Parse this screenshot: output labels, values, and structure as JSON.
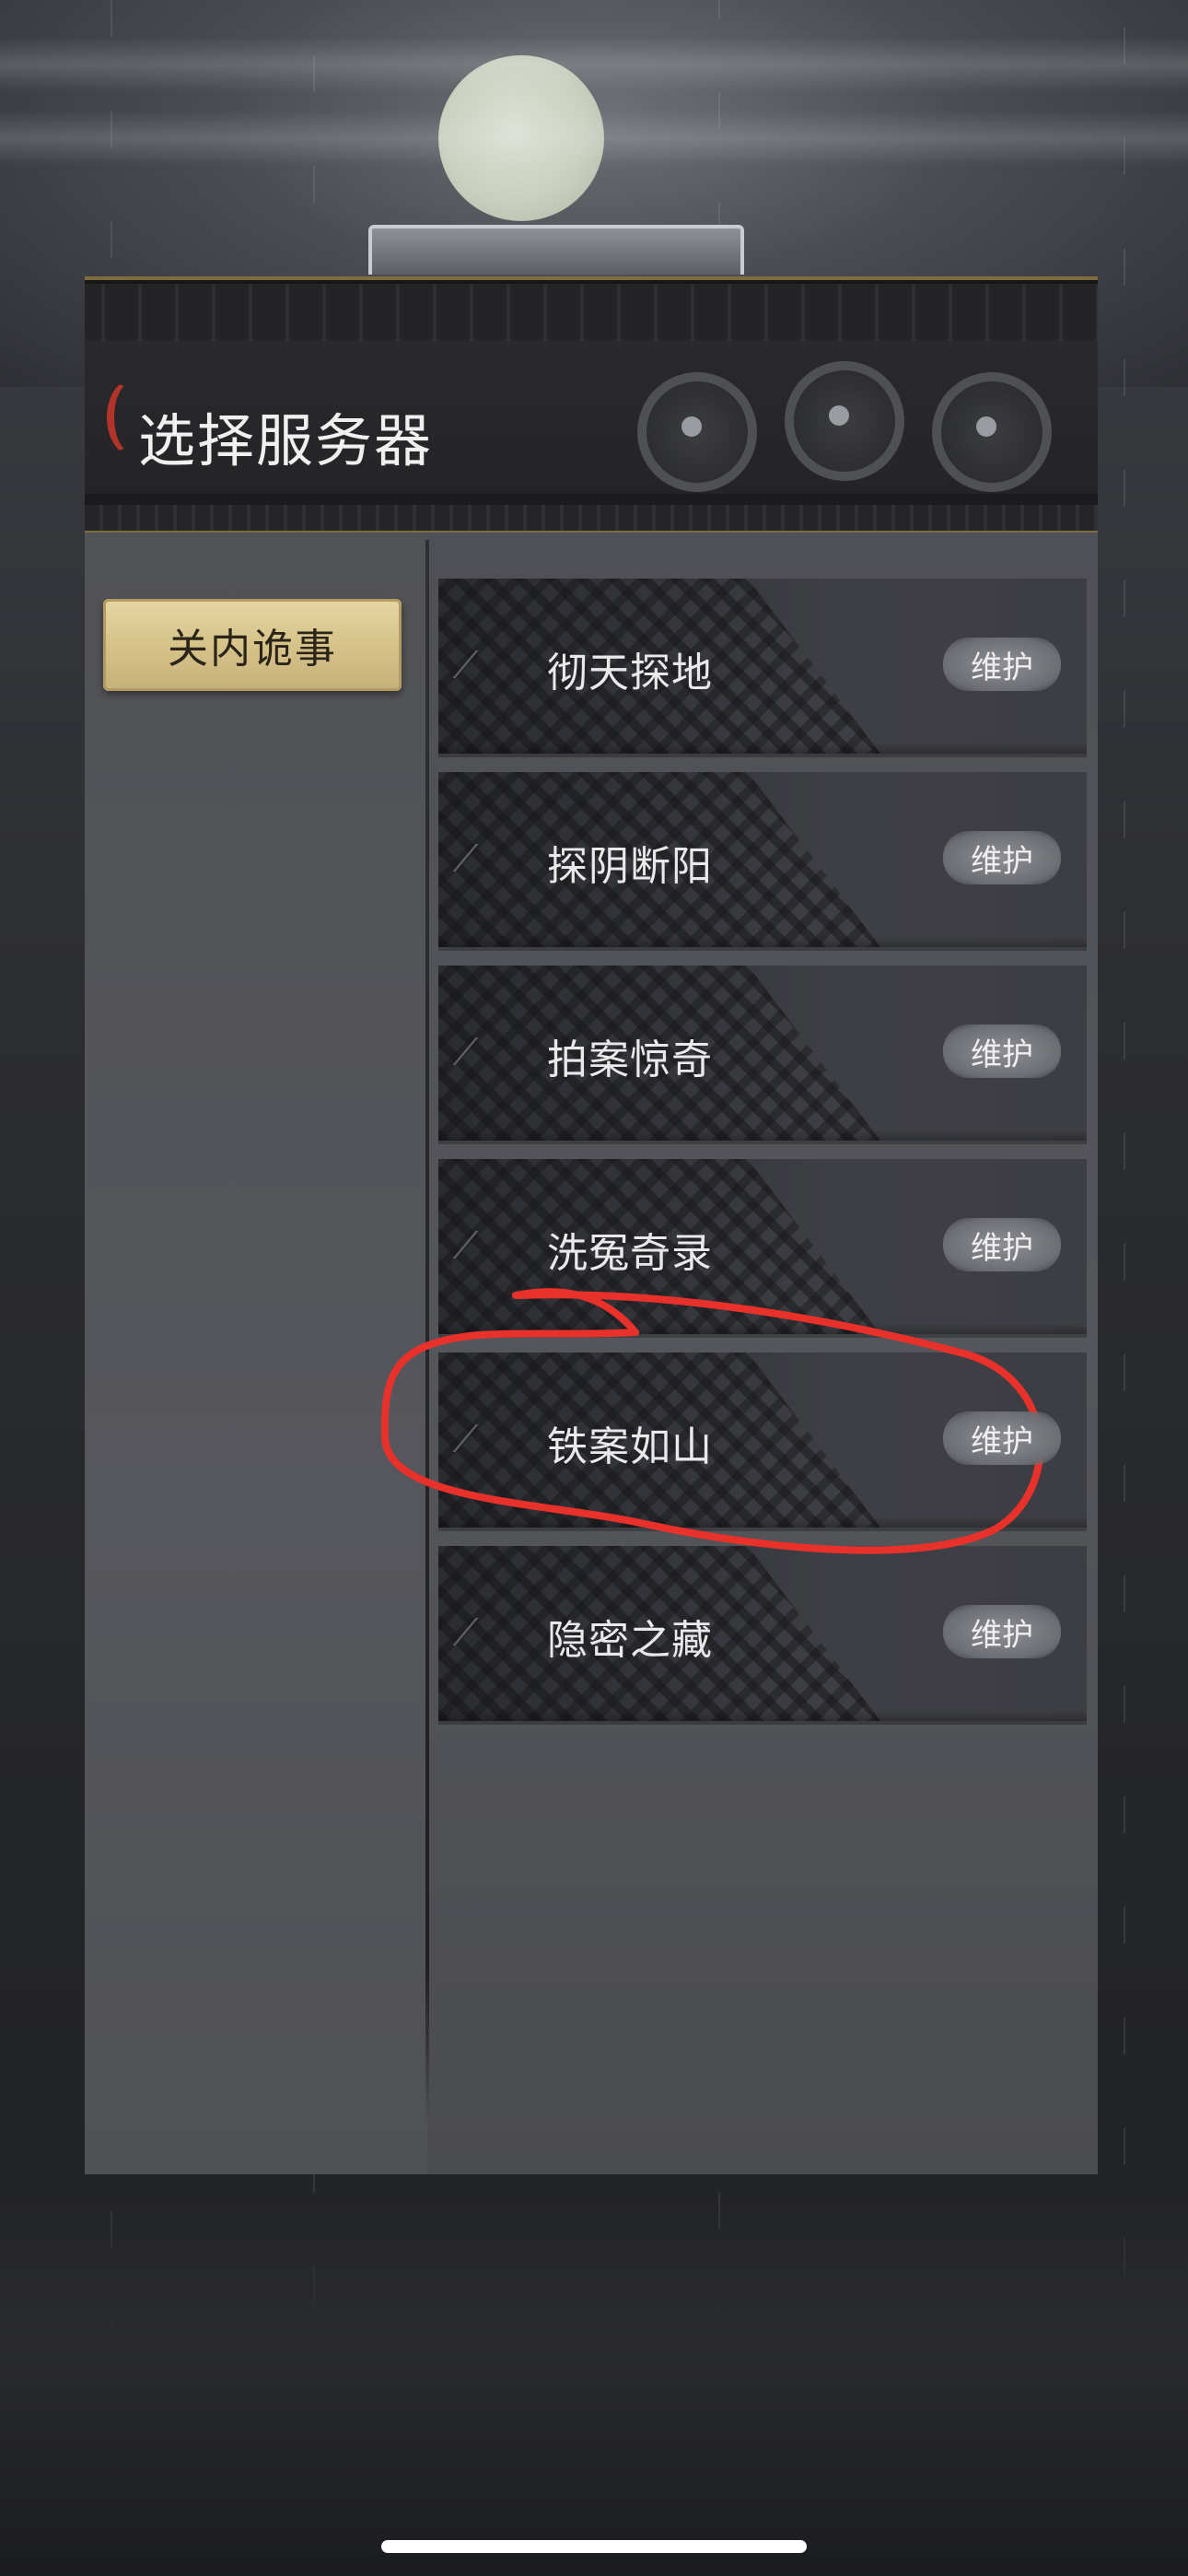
{
  "header": {
    "title": "选择服务器"
  },
  "sidebar": {
    "regions": [
      {
        "label": "关内诡事",
        "selected": true
      }
    ]
  },
  "servers": [
    {
      "name": "彻天探地",
      "status": "维护"
    },
    {
      "name": "探阴断阳",
      "status": "维护"
    },
    {
      "name": "拍案惊奇",
      "status": "维护"
    },
    {
      "name": "洗冤奇录",
      "status": "维护"
    },
    {
      "name": "铁案如山",
      "status": "维护"
    },
    {
      "name": "隐密之藏",
      "status": "维护"
    }
  ],
  "colors": {
    "accent_gold": "#d6c38a",
    "annotation_red": "#e8312a",
    "badge_gray": "#7a7c80"
  }
}
